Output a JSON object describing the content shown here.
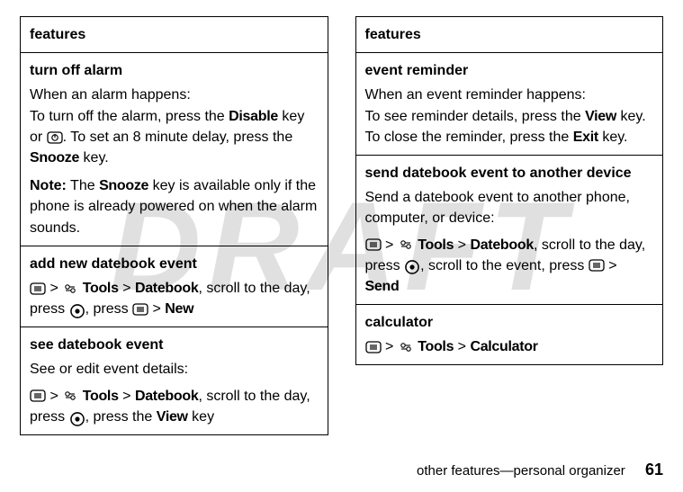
{
  "watermark": "DRAFT",
  "left": {
    "header": "features",
    "rows": [
      {
        "title": "turn off alarm",
        "p1": "When an alarm happens:",
        "p2a": "To turn off the alarm, press the ",
        "disable": "Disable",
        "p2b": " key or ",
        "p2c": ". To set an 8 minute delay, press the ",
        "snooze": "Snooze",
        "p2d": " key.",
        "note_label": "Note:",
        "note_a": " The ",
        "note_snooze": "Snooze",
        "note_b": " key is available only if the phone is already powered on when the alarm sounds."
      },
      {
        "title": "add new datebook event",
        "tools": "Tools",
        "datebook": "Datebook",
        "scroll": ", scroll to the day, press ",
        "press": ", press ",
        "new": "New"
      },
      {
        "title": "see datebook event",
        "desc": "See or edit event details:",
        "tools": "Tools",
        "datebook": "Datebook",
        "scroll": ", scroll to the day, press ",
        "press2": ", press the ",
        "view": "View",
        "key": " key"
      }
    ]
  },
  "right": {
    "header": "features",
    "rows": [
      {
        "title": "event reminder",
        "p1": "When an event reminder happens:",
        "p2a": "To see reminder details, press the ",
        "view": "View",
        "p2b": " key. To close the reminder, press the ",
        "exit": "Exit",
        "p2c": " key."
      },
      {
        "title": "send datebook event to another device",
        "desc": "Send a datebook event to another phone, computer, or device:",
        "tools": "Tools",
        "datebook": "Datebook",
        "scroll": ", scroll to the day, press ",
        "scroll2": ", scroll to the event, press ",
        "send": "Send"
      },
      {
        "title": "calculator",
        "tools": "Tools",
        "calc": "Calculator"
      }
    ]
  },
  "footer": {
    "text": "other features—personal organizer",
    "page": "61"
  },
  "gt": ">"
}
